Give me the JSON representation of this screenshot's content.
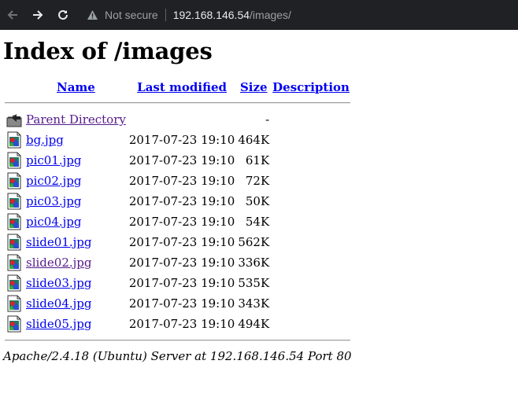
{
  "browser": {
    "security_label": "Not secure",
    "url_host": "192.168.146.54",
    "url_path": "/images/"
  },
  "page": {
    "title": "Index of /images",
    "columns": {
      "name": "Name",
      "last_modified": "Last modified",
      "size": "Size",
      "description": "Description"
    },
    "parent": {
      "label": "Parent Directory",
      "size": "-"
    },
    "files": [
      {
        "name": "bg.jpg",
        "modified": "2017-07-23 19:10",
        "size": "464K"
      },
      {
        "name": "pic01.jpg",
        "modified": "2017-07-23 19:10",
        "size": "61K"
      },
      {
        "name": "pic02.jpg",
        "modified": "2017-07-23 19:10",
        "size": "72K"
      },
      {
        "name": "pic03.jpg",
        "modified": "2017-07-23 19:10",
        "size": "50K"
      },
      {
        "name": "pic04.jpg",
        "modified": "2017-07-23 19:10",
        "size": "54K"
      },
      {
        "name": "slide01.jpg",
        "modified": "2017-07-23 19:10",
        "size": "562K"
      },
      {
        "name": "slide02.jpg",
        "modified": "2017-07-23 19:10",
        "size": "336K"
      },
      {
        "name": "slide03.jpg",
        "modified": "2017-07-23 19:10",
        "size": "535K"
      },
      {
        "name": "slide04.jpg",
        "modified": "2017-07-23 19:10",
        "size": "343K"
      },
      {
        "name": "slide05.jpg",
        "modified": "2017-07-23 19:10",
        "size": "494K"
      }
    ],
    "footer": "Apache/2.4.18 (Ubuntu) Server at 192.168.146.54 Port 80"
  },
  "colors": {
    "link": "#0000ee",
    "visited": "#551a8b",
    "toolbar": "#202124"
  },
  "icons": {
    "back": "arrow-left-icon",
    "forward": "arrow-right-icon",
    "reload": "reload-icon",
    "warning": "warning-triangle-icon",
    "parent": "back-folder-icon",
    "file": "image-file-icon"
  }
}
